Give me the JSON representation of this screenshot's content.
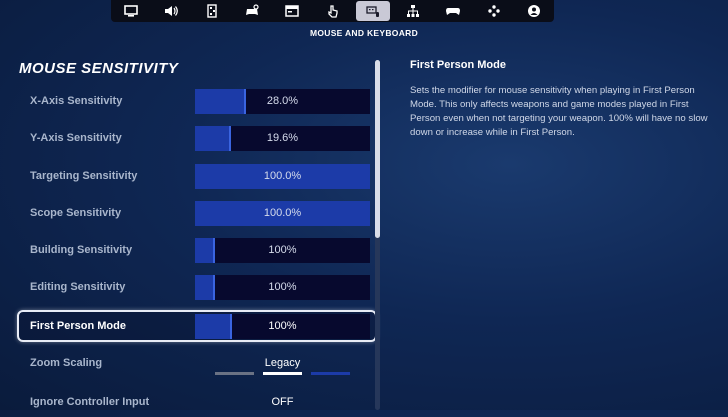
{
  "nav": {
    "tabs": [
      {
        "icon": "monitor-icon",
        "active": false
      },
      {
        "icon": "speaker-icon",
        "active": false
      },
      {
        "icon": "game-ui-icon",
        "active": false
      },
      {
        "icon": "controller-settings-icon",
        "active": false
      },
      {
        "icon": "account-card-icon",
        "active": false
      },
      {
        "icon": "touch-icon",
        "active": false
      },
      {
        "icon": "keyboard-mouse-icon",
        "active": true
      },
      {
        "icon": "network-icon",
        "active": false
      },
      {
        "icon": "controller-icon",
        "active": false
      },
      {
        "icon": "gamepad-dpad-icon",
        "active": false
      },
      {
        "icon": "profile-icon",
        "active": false
      }
    ],
    "active_section": "MOUSE AND KEYBOARD"
  },
  "heading": "MOUSE SENSITIVITY",
  "settings": [
    {
      "label": "X-Axis Sensitivity",
      "value": "28.0%",
      "fill": 0.28
    },
    {
      "label": "Y-Axis Sensitivity",
      "value": "19.6%",
      "fill": 0.196
    },
    {
      "label": "Targeting Sensitivity",
      "value": "100.0%",
      "fill": 1.0
    },
    {
      "label": "Scope Sensitivity",
      "value": "100.0%",
      "fill": 1.0
    },
    {
      "label": "Building Sensitivity",
      "value": "100%",
      "fill": 0.1
    },
    {
      "label": "Editing Sensitivity",
      "value": "100%",
      "fill": 0.1
    },
    {
      "label": "First Person Mode",
      "value": "100%",
      "fill": 0.2
    }
  ],
  "zoom_scaling": {
    "label": "Zoom Scaling",
    "value": "Legacy",
    "options_count": 3,
    "selected_index": 1
  },
  "ignore_controller": {
    "label": "Ignore Controller Input",
    "value": "OFF"
  },
  "description": {
    "title": "First Person Mode",
    "body": "Sets the modifier for mouse sensitivity when playing in First Person Mode. This only affects weapons and game modes played in First Person even when not targeting your weapon. 100% will have no slow down or increase while in First Person."
  },
  "colors": {
    "bar_bg": "#07092e",
    "bar_fill": "#1c3ba8",
    "accent": "#3a64e0",
    "background": "#0f2754"
  }
}
